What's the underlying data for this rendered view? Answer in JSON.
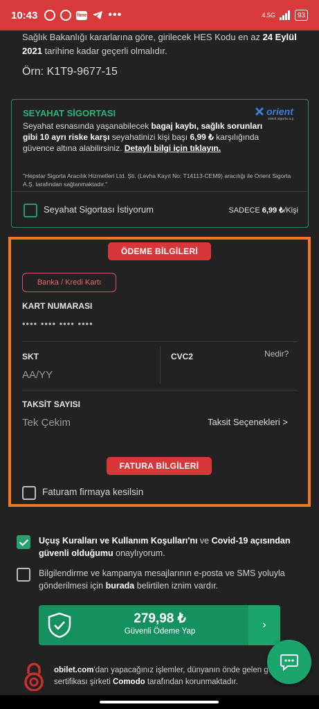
{
  "status_bar": {
    "time": "10:43",
    "fime_badge": "fime",
    "network": "4.5G",
    "battery": "93"
  },
  "hes": {
    "text_a": "Sağlık Bakanlığı kararlarına göre, girilecek HES Kodu en az ",
    "date_bold": "24 Eylül 2021",
    "text_b": " tarihine kadar geçerli olmalıdır.",
    "example": "Örn: K1T9-9677-15"
  },
  "insurance": {
    "title": "SEYAHAT SİGORTASI",
    "logo_text": "orient",
    "logo_sub": "orient sigorta a.ş.",
    "desc_1": "Seyahat esnasında yaşanabilecek ",
    "desc_b1": "bagaj kaybı, sağlık sorunları gibi 10 ayrı riske karşı",
    "desc_2": " seyahatinizi kişi başı ",
    "desc_b2": "6,99 ₺",
    "desc_3": " karşılığında güvence altına alabilirsiniz. ",
    "detail_link": "Detaylı bilgi için tıklayın.",
    "note": "\"Hepstar Sigorta Aracılık Hizmetleri Ltd. Şti. (Levha Kayıt No: T14113-CEM9) aracılığı ile Orient Sigorta A.Ş. tarafından sağlanmaktadır.\"",
    "checkbox_label": "Seyahat Sigortası İstiyorum",
    "price_prefix": "SADECE ",
    "price_value": "6,99 ₺",
    "price_suffix": "/Kişi",
    "checked": false
  },
  "payment": {
    "section_title": "ÖDEME BİLGİLERİ",
    "method_tab": "Banka / Kredi Kartı",
    "card_label": "KART NUMARASI",
    "card_placeholder": "•••• •••• •••• ••••",
    "skt_label": "SKT",
    "skt_placeholder": "AA/YY",
    "cvc_label": "CVC2",
    "cvc_help": "Nedir?",
    "installment_label": "TAKSİT SAYISI",
    "installment_value": "Tek Çekim",
    "installment_options": "Taksit Seçenekleri >"
  },
  "invoice": {
    "section_title": "FATURA BİLGİLERİ",
    "company_checkbox": "Faturam firmaya kesilsin",
    "checked": false
  },
  "agreements": [
    {
      "bold_a": "Uçuş Kuralları ve Kullanım Koşulları'nı",
      "plain_a": " ve ",
      "bold_b": "Covid-19 açısından güvenli olduğumu",
      "plain_b": " onaylıyorum.",
      "checked": true
    },
    {
      "plain_a": "Bilgilendirme ve kampanya mesajlarının e-posta ve SMS yoluyla gönderilmesi için ",
      "bold_a": "burada",
      "plain_b": " belirtilen iznim vardır.",
      "checked": false
    }
  ],
  "pay_button": {
    "amount": "279,98 ₺",
    "label": "Güvenli Ödeme Yap",
    "arrow": "›"
  },
  "security": {
    "brand": "obilet.com",
    "text_a": "'dan yapacağınız işlemler, dünyanın önde gelen güvenlik sertifikası şirketi ",
    "company": "Comodo",
    "text_b": " tarafından korunmaktadır."
  },
  "colors": {
    "accent_red": "#d8373a",
    "accent_green": "#15905f",
    "highlight_orange": "#f07a22",
    "background": "#222222"
  }
}
